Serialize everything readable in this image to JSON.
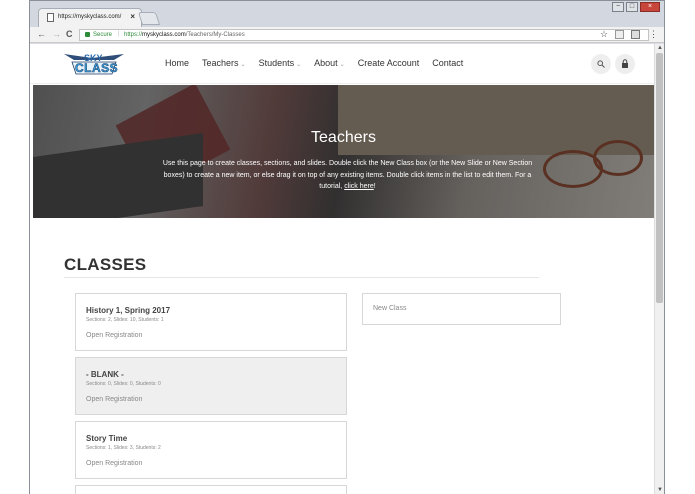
{
  "browser": {
    "tab_title": "https://myskyclass.com/",
    "tab_close": "×",
    "secure_label": "Secure",
    "url_scheme": "https://",
    "url_host": "myskyclass.com",
    "url_path": "/Teachers/My-Classes",
    "back": "←",
    "forward": "→",
    "reload": "C",
    "star": "☆",
    "menu": "⋮",
    "win_min": "−",
    "win_max": "□",
    "win_close": "×"
  },
  "site": {
    "logo_sky": "SKY",
    "logo_class": "CLASS",
    "nav": [
      {
        "label": "Home",
        "dropdown": false
      },
      {
        "label": "Teachers",
        "dropdown": true
      },
      {
        "label": "Students",
        "dropdown": true
      },
      {
        "label": "About",
        "dropdown": true
      },
      {
        "label": "Create Account",
        "dropdown": false
      },
      {
        "label": "Contact",
        "dropdown": false
      }
    ],
    "search_icon": "search-icon",
    "lock_icon": "lock-icon"
  },
  "hero": {
    "title": "Teachers",
    "text": "Use this page to create classes, sections, and slides. Double click the New Class box (or the New Slide or New Section boxes) to create a new item, or else drag it on top of any existing items. Double click items in the list to edit them. For a tutorial, ",
    "link": "click here",
    "text_end": "!"
  },
  "classes": {
    "heading": "CLASSES",
    "new_class_label": "New Class",
    "items": [
      {
        "title": "History 1, Spring 2017",
        "meta": "Sections: 2, Slides: 10, Students: 1",
        "link": "Open Registration",
        "blank": false
      },
      {
        "title": "- BLANK -",
        "meta": "Sections: 0, Slides: 0, Students: 0",
        "link": "Open Registration",
        "blank": true
      },
      {
        "title": "Story Time",
        "meta": "Sections: 1, Slides: 3, Students: 2",
        "link": "Open Registration",
        "blank": false
      }
    ]
  },
  "colors": {
    "secure_green": "#2e8b3a",
    "logo_blue": "#3ba0df",
    "heading_gray": "#333333"
  }
}
